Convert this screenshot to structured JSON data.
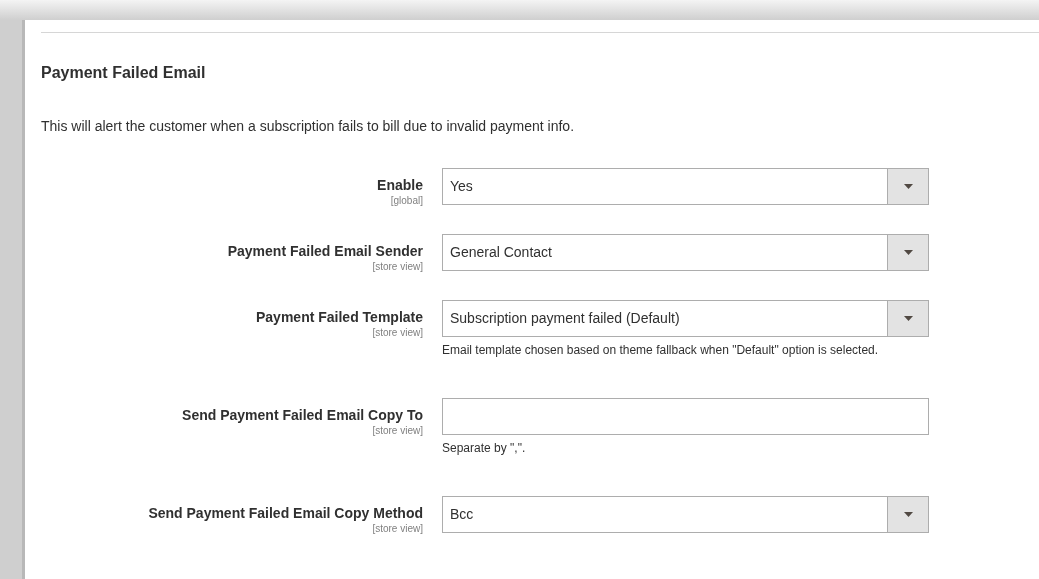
{
  "section": {
    "title": "Payment Failed Email",
    "description": "This will alert the customer when a subscription fails to bill due to invalid payment info."
  },
  "fields": [
    {
      "kind": "select",
      "label": "Enable",
      "scope": "[global]",
      "value": "Yes"
    },
    {
      "kind": "select",
      "label": "Payment Failed Email Sender",
      "scope": "[store view]",
      "value": "General Contact"
    },
    {
      "kind": "select",
      "label": "Payment Failed Template",
      "scope": "[store view]",
      "value": "Subscription payment failed (Default)",
      "note": "Email template chosen based on theme fallback when \"Default\" option is selected."
    },
    {
      "kind": "text",
      "label": "Send Payment Failed Email Copy To",
      "scope": "[store view]",
      "note": "Separate by \",\"."
    },
    {
      "kind": "select",
      "label": "Send Payment Failed Email Copy Method",
      "scope": "[store view]",
      "value": "Bcc"
    }
  ]
}
